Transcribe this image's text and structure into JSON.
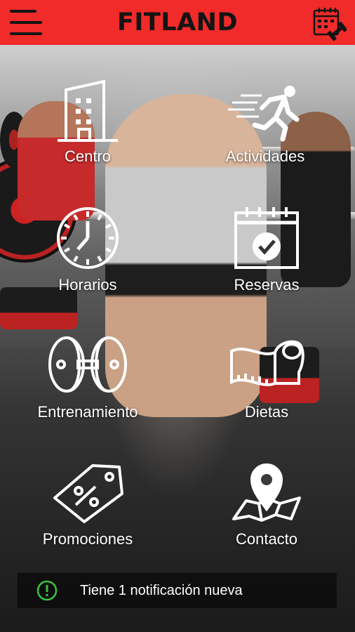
{
  "header": {
    "title": "FITLAND",
    "color": "#f12a2a",
    "menu_icon": "hamburger-menu-icon",
    "right_icon": "calendar-dumbbell-icon"
  },
  "menu": [
    {
      "label": "Centro",
      "icon": "building-icon"
    },
    {
      "label": "Actividades",
      "icon": "running-person-icon"
    },
    {
      "label": "Horarios",
      "icon": "clock-icon"
    },
    {
      "label": "Reservas",
      "icon": "calendar-check-icon"
    },
    {
      "label": "Entrenamiento",
      "icon": "dumbbell-icon"
    },
    {
      "label": "Dietas",
      "icon": "measuring-tape-icon"
    },
    {
      "label": "Promociones",
      "icon": "discount-tag-icon"
    },
    {
      "label": "Contacto",
      "icon": "map-pin-icon"
    }
  ],
  "notification": {
    "text": "Tiene 1 notificación nueva",
    "icon": "exclamation-circle-icon",
    "icon_color": "#3cc23c"
  }
}
